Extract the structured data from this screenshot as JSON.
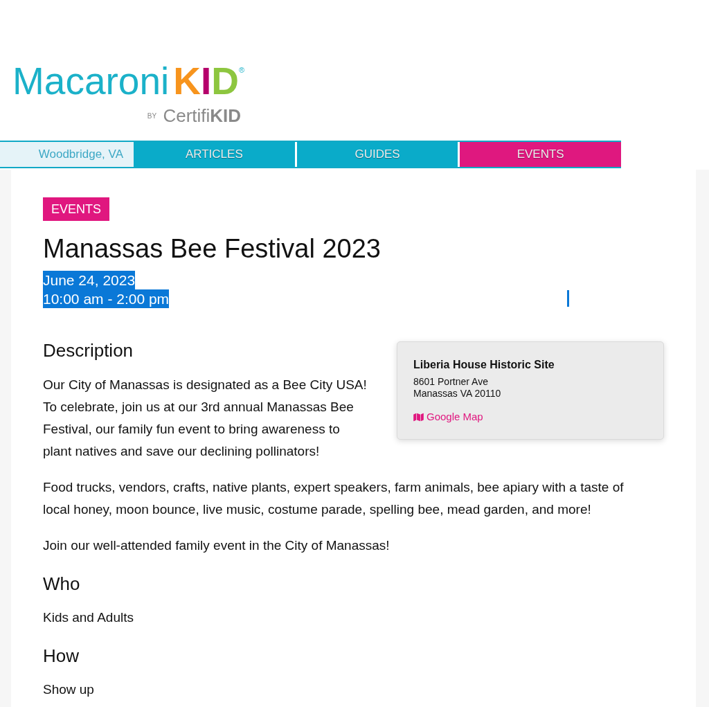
{
  "logo": {
    "name": "Macaroni",
    "kid_letters": [
      {
        "text": "K",
        "color": "#f7941d"
      },
      {
        "text": "I",
        "color": "#b5006b"
      },
      {
        "text": "D",
        "color": "#8dc63f"
      }
    ],
    "registered": "®",
    "byline": "$^{BY}$ Certifi**KID**"
  },
  "nav": {
    "location": "Woodbridge, VA",
    "tabs": [
      {
        "label": "ARTICLES",
        "selected": false
      },
      {
        "label": "GUIDES",
        "selected": false
      },
      {
        "label": "EVENTS",
        "selected": true
      }
    ]
  },
  "article": {
    "category": "EVENTS",
    "title": "Manassas Bee Festival 2023",
    "date": "June 24, 2023",
    "time": "10:00 am - 2:00 pm",
    "date_highlighted": true,
    "sections": [
      {
        "heading": "Description",
        "paragraphs": [
          "Our City of Manassas is designated as a Bee City USA! To celebrate, join us at our 3rd annual Manassas Bee Festival, our family fun event to bring awareness to plant natives and save our declining pollinators!",
          "Food trucks, vendors, crafts, native plants, expert speakers, farm animals, bee apiary with a taste of local honey, moon bounce, live music, costume parade, spelling bee, mead garden, and more!",
          "Join our well-attended family event in the City of Manassas!"
        ],
        "location": {
          "name": "Liberia House Historic Site",
          "address_lines": [
            "8601 Portner Ave",
            "Manassas VA 20110"
          ],
          "map_link": "Google Map"
        }
      },
      {
        "heading": "Who",
        "paragraphs": [
          "Kids and Adults"
        ]
      },
      {
        "heading": "How",
        "paragraphs": [
          "Show up"
        ]
      }
    ]
  }
}
